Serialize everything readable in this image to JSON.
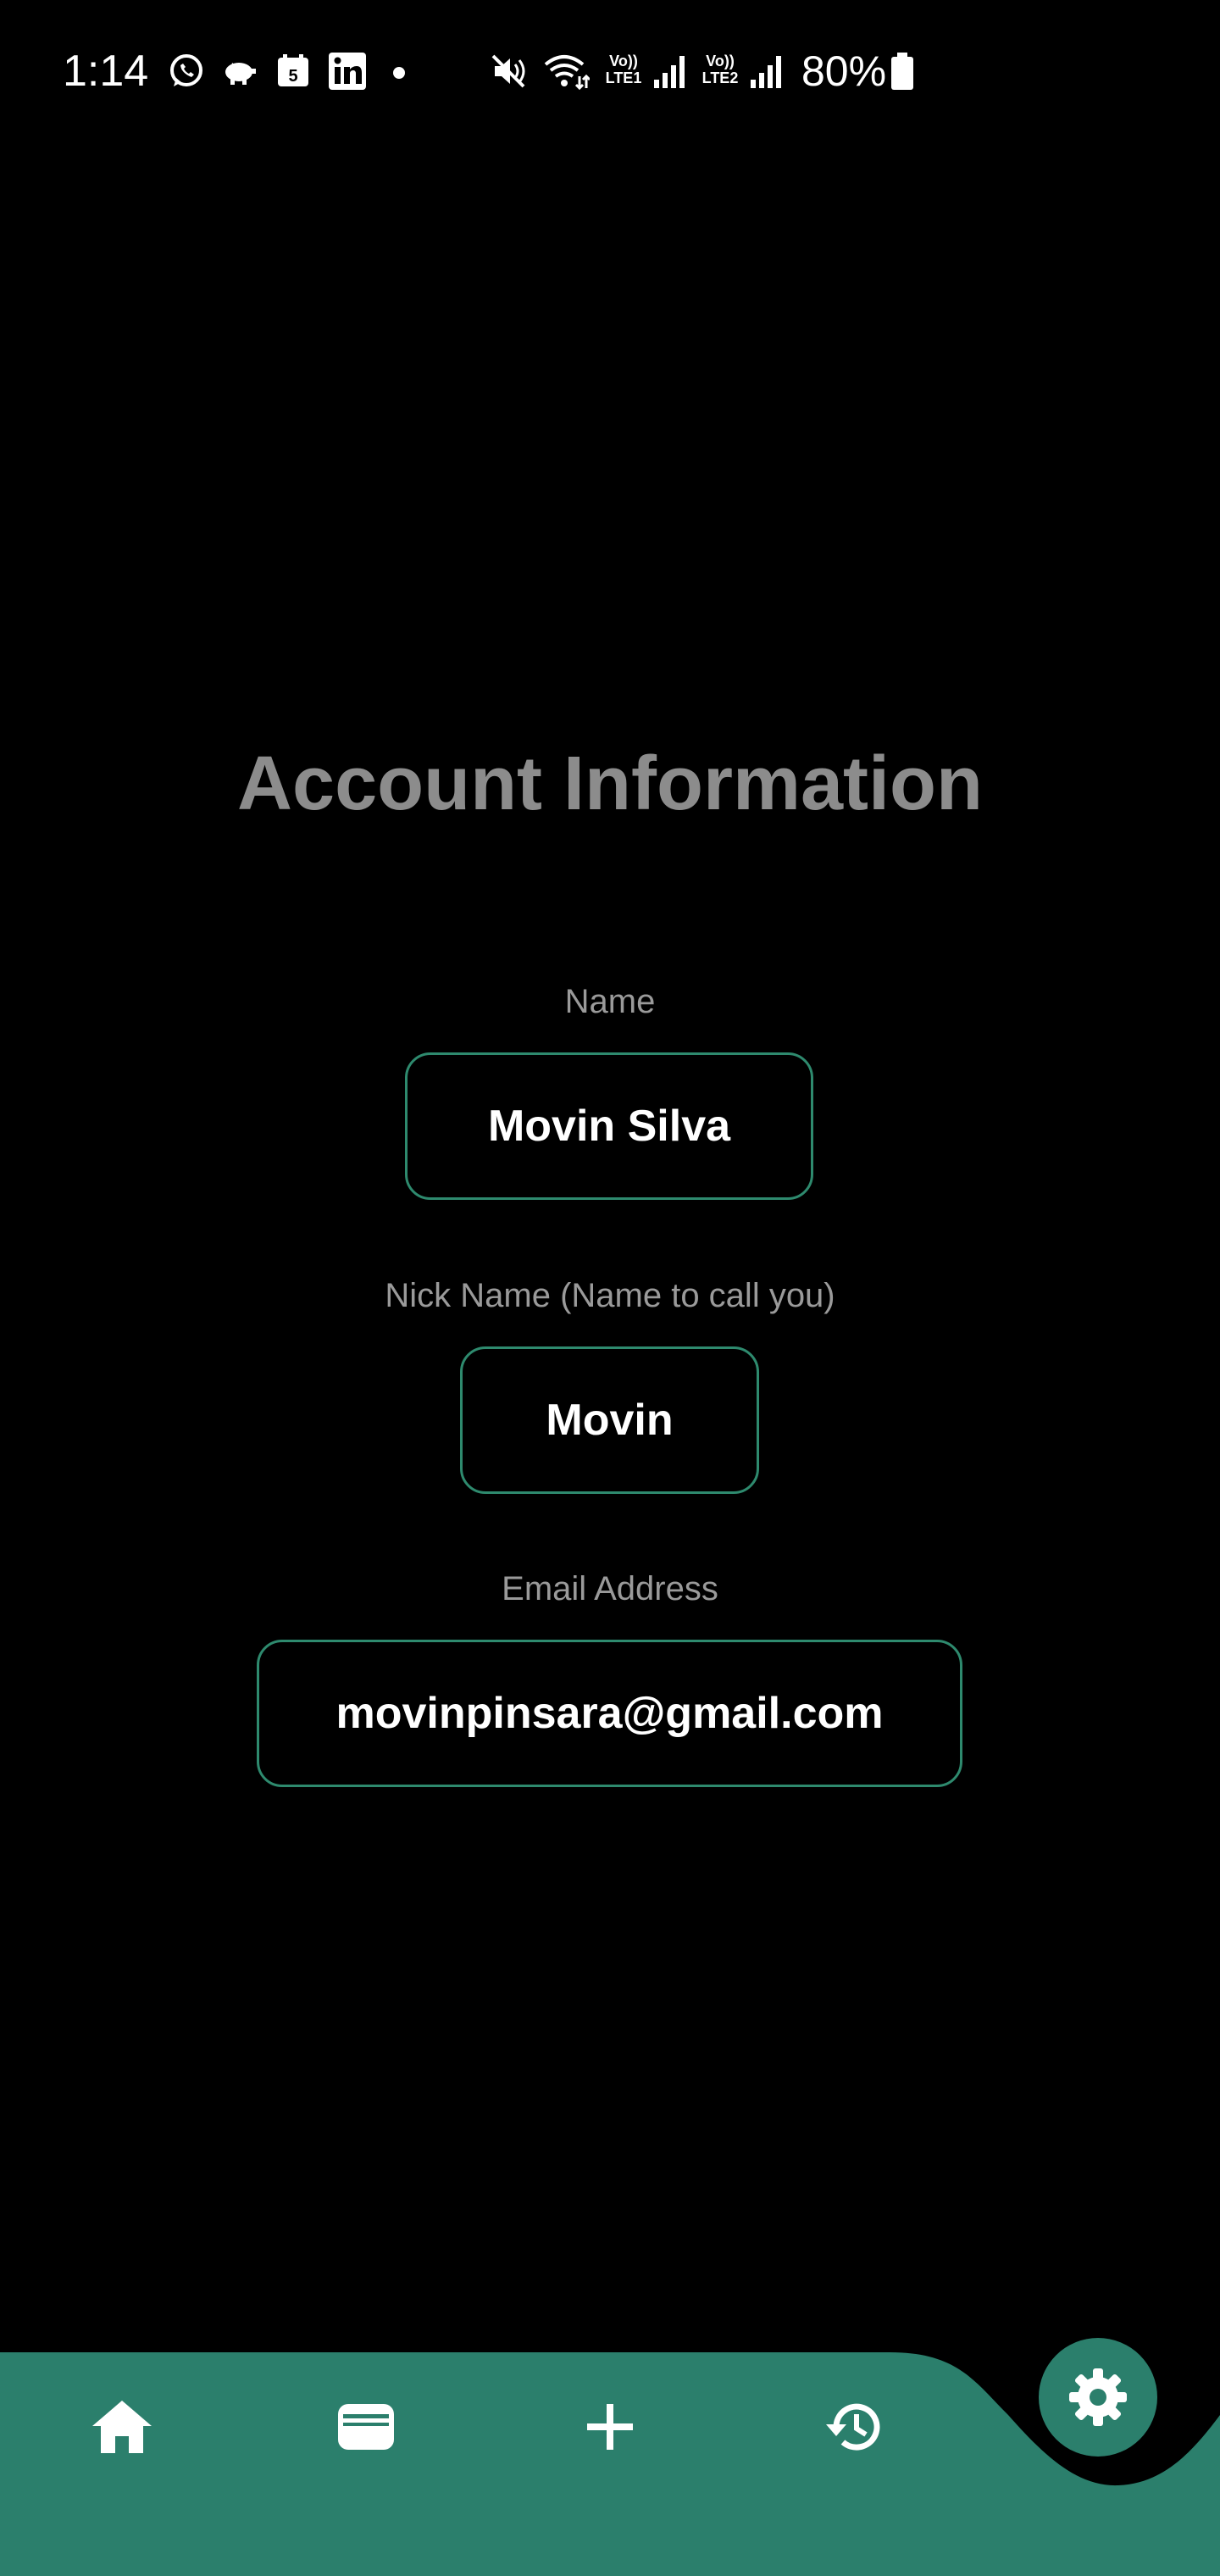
{
  "status_bar": {
    "time": "1:14",
    "notification_icons": [
      "whatsapp-icon",
      "piggy-bank-icon",
      "calendar-icon",
      "linkedin-icon",
      "dot-icon"
    ],
    "calendar_day": "5",
    "system_icons": [
      "mute-icon",
      "wifi-icon",
      "lte1-signal-icon",
      "lte2-signal-icon",
      "battery-icon"
    ],
    "lte1_label_top": "Vo))",
    "lte1_label_bottom": "LTE1",
    "lte2_label_top": "Vo))",
    "lte2_label_bottom": "LTE2",
    "battery": "80%"
  },
  "page": {
    "title": "Account Information"
  },
  "fields": {
    "name": {
      "label": "Name",
      "value": "Movin Silva"
    },
    "nickname": {
      "label": "Nick Name (Name to call you)",
      "value": "Movin"
    },
    "email": {
      "label": "Email Address",
      "value": "movinpinsara@gmail.com"
    }
  },
  "bottom_nav": {
    "items": [
      {
        "icon": "home-icon"
      },
      {
        "icon": "wallet-icon"
      },
      {
        "icon": "plus-icon"
      },
      {
        "icon": "history-icon"
      }
    ],
    "active_item": {
      "icon": "settings-gear-icon"
    }
  },
  "colors": {
    "background": "#000000",
    "accent": "#2b7f6c",
    "field_border": "#2e8a6e",
    "title": "#8c8c8c",
    "label": "#9a9a9a",
    "text": "#ffffff"
  }
}
